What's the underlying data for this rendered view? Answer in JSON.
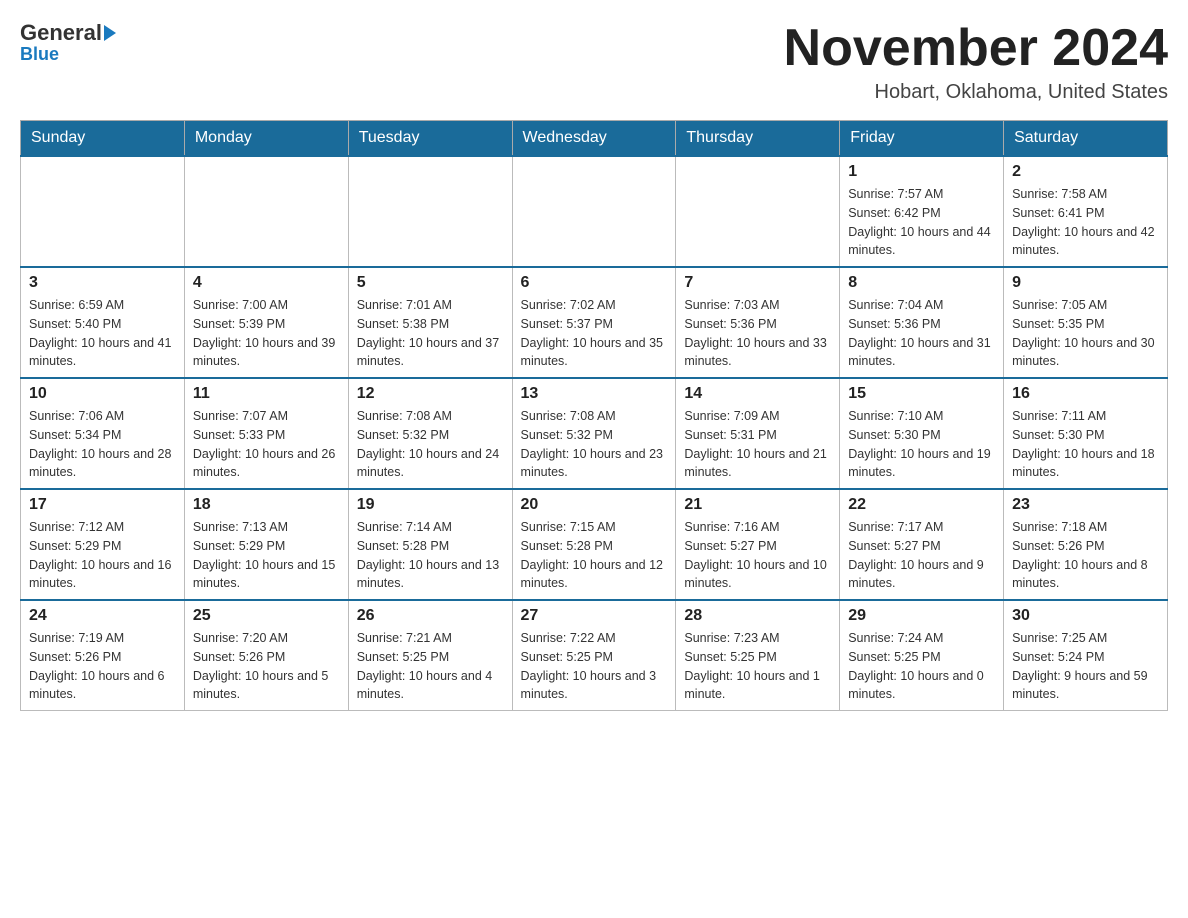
{
  "logo": {
    "general": "General",
    "blue": "Blue"
  },
  "title": "November 2024",
  "subtitle": "Hobart, Oklahoma, United States",
  "days_of_week": [
    "Sunday",
    "Monday",
    "Tuesday",
    "Wednesday",
    "Thursday",
    "Friday",
    "Saturday"
  ],
  "weeks": [
    [
      {
        "day": "",
        "sunrise": "",
        "sunset": "",
        "daylight": ""
      },
      {
        "day": "",
        "sunrise": "",
        "sunset": "",
        "daylight": ""
      },
      {
        "day": "",
        "sunrise": "",
        "sunset": "",
        "daylight": ""
      },
      {
        "day": "",
        "sunrise": "",
        "sunset": "",
        "daylight": ""
      },
      {
        "day": "",
        "sunrise": "",
        "sunset": "",
        "daylight": ""
      },
      {
        "day": "1",
        "sunrise": "Sunrise: 7:57 AM",
        "sunset": "Sunset: 6:42 PM",
        "daylight": "Daylight: 10 hours and 44 minutes."
      },
      {
        "day": "2",
        "sunrise": "Sunrise: 7:58 AM",
        "sunset": "Sunset: 6:41 PM",
        "daylight": "Daylight: 10 hours and 42 minutes."
      }
    ],
    [
      {
        "day": "3",
        "sunrise": "Sunrise: 6:59 AM",
        "sunset": "Sunset: 5:40 PM",
        "daylight": "Daylight: 10 hours and 41 minutes."
      },
      {
        "day": "4",
        "sunrise": "Sunrise: 7:00 AM",
        "sunset": "Sunset: 5:39 PM",
        "daylight": "Daylight: 10 hours and 39 minutes."
      },
      {
        "day": "5",
        "sunrise": "Sunrise: 7:01 AM",
        "sunset": "Sunset: 5:38 PM",
        "daylight": "Daylight: 10 hours and 37 minutes."
      },
      {
        "day": "6",
        "sunrise": "Sunrise: 7:02 AM",
        "sunset": "Sunset: 5:37 PM",
        "daylight": "Daylight: 10 hours and 35 minutes."
      },
      {
        "day": "7",
        "sunrise": "Sunrise: 7:03 AM",
        "sunset": "Sunset: 5:36 PM",
        "daylight": "Daylight: 10 hours and 33 minutes."
      },
      {
        "day": "8",
        "sunrise": "Sunrise: 7:04 AM",
        "sunset": "Sunset: 5:36 PM",
        "daylight": "Daylight: 10 hours and 31 minutes."
      },
      {
        "day": "9",
        "sunrise": "Sunrise: 7:05 AM",
        "sunset": "Sunset: 5:35 PM",
        "daylight": "Daylight: 10 hours and 30 minutes."
      }
    ],
    [
      {
        "day": "10",
        "sunrise": "Sunrise: 7:06 AM",
        "sunset": "Sunset: 5:34 PM",
        "daylight": "Daylight: 10 hours and 28 minutes."
      },
      {
        "day": "11",
        "sunrise": "Sunrise: 7:07 AM",
        "sunset": "Sunset: 5:33 PM",
        "daylight": "Daylight: 10 hours and 26 minutes."
      },
      {
        "day": "12",
        "sunrise": "Sunrise: 7:08 AM",
        "sunset": "Sunset: 5:32 PM",
        "daylight": "Daylight: 10 hours and 24 minutes."
      },
      {
        "day": "13",
        "sunrise": "Sunrise: 7:08 AM",
        "sunset": "Sunset: 5:32 PM",
        "daylight": "Daylight: 10 hours and 23 minutes."
      },
      {
        "day": "14",
        "sunrise": "Sunrise: 7:09 AM",
        "sunset": "Sunset: 5:31 PM",
        "daylight": "Daylight: 10 hours and 21 minutes."
      },
      {
        "day": "15",
        "sunrise": "Sunrise: 7:10 AM",
        "sunset": "Sunset: 5:30 PM",
        "daylight": "Daylight: 10 hours and 19 minutes."
      },
      {
        "day": "16",
        "sunrise": "Sunrise: 7:11 AM",
        "sunset": "Sunset: 5:30 PM",
        "daylight": "Daylight: 10 hours and 18 minutes."
      }
    ],
    [
      {
        "day": "17",
        "sunrise": "Sunrise: 7:12 AM",
        "sunset": "Sunset: 5:29 PM",
        "daylight": "Daylight: 10 hours and 16 minutes."
      },
      {
        "day": "18",
        "sunrise": "Sunrise: 7:13 AM",
        "sunset": "Sunset: 5:29 PM",
        "daylight": "Daylight: 10 hours and 15 minutes."
      },
      {
        "day": "19",
        "sunrise": "Sunrise: 7:14 AM",
        "sunset": "Sunset: 5:28 PM",
        "daylight": "Daylight: 10 hours and 13 minutes."
      },
      {
        "day": "20",
        "sunrise": "Sunrise: 7:15 AM",
        "sunset": "Sunset: 5:28 PM",
        "daylight": "Daylight: 10 hours and 12 minutes."
      },
      {
        "day": "21",
        "sunrise": "Sunrise: 7:16 AM",
        "sunset": "Sunset: 5:27 PM",
        "daylight": "Daylight: 10 hours and 10 minutes."
      },
      {
        "day": "22",
        "sunrise": "Sunrise: 7:17 AM",
        "sunset": "Sunset: 5:27 PM",
        "daylight": "Daylight: 10 hours and 9 minutes."
      },
      {
        "day": "23",
        "sunrise": "Sunrise: 7:18 AM",
        "sunset": "Sunset: 5:26 PM",
        "daylight": "Daylight: 10 hours and 8 minutes."
      }
    ],
    [
      {
        "day": "24",
        "sunrise": "Sunrise: 7:19 AM",
        "sunset": "Sunset: 5:26 PM",
        "daylight": "Daylight: 10 hours and 6 minutes."
      },
      {
        "day": "25",
        "sunrise": "Sunrise: 7:20 AM",
        "sunset": "Sunset: 5:26 PM",
        "daylight": "Daylight: 10 hours and 5 minutes."
      },
      {
        "day": "26",
        "sunrise": "Sunrise: 7:21 AM",
        "sunset": "Sunset: 5:25 PM",
        "daylight": "Daylight: 10 hours and 4 minutes."
      },
      {
        "day": "27",
        "sunrise": "Sunrise: 7:22 AM",
        "sunset": "Sunset: 5:25 PM",
        "daylight": "Daylight: 10 hours and 3 minutes."
      },
      {
        "day": "28",
        "sunrise": "Sunrise: 7:23 AM",
        "sunset": "Sunset: 5:25 PM",
        "daylight": "Daylight: 10 hours and 1 minute."
      },
      {
        "day": "29",
        "sunrise": "Sunrise: 7:24 AM",
        "sunset": "Sunset: 5:25 PM",
        "daylight": "Daylight: 10 hours and 0 minutes."
      },
      {
        "day": "30",
        "sunrise": "Sunrise: 7:25 AM",
        "sunset": "Sunset: 5:24 PM",
        "daylight": "Daylight: 9 hours and 59 minutes."
      }
    ]
  ]
}
